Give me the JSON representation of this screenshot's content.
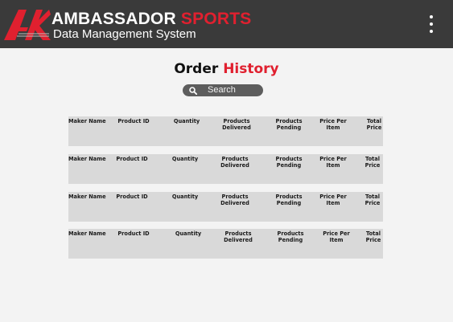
{
  "header": {
    "brand_main": "AMBASSADOR",
    "brand_accent": "SPORTS",
    "tagline": "Data Management System",
    "colors": {
      "background": "#3a3a3a",
      "accent": "#e0202f",
      "text": "#ffffff"
    },
    "menu_icon": "kebab-menu-icon"
  },
  "page": {
    "title_main": "Order",
    "title_accent": "History"
  },
  "search": {
    "placeholder": "Search",
    "icon": "search-icon"
  },
  "orders": [
    {
      "maker": "Maker Name",
      "product_id": "Product ID",
      "quantity": "Quantity",
      "delivered_1": "Products",
      "delivered_2": "Delivered",
      "pending_1": "Products",
      "pending_2": "Pending",
      "price_1": "Price Per",
      "price_2": "Item",
      "total_1": "Total",
      "total_2": "Price"
    },
    {
      "maker": "Maker Name",
      "product_id": "Product ID",
      "quantity": "Quantity",
      "delivered_1": "Products",
      "delivered_2": "Delivered",
      "pending_1": "Products",
      "pending_2": "Pending",
      "price_1": "Price Per",
      "price_2": "Item",
      "total_1": "Total",
      "total_2": "Price"
    },
    {
      "maker": "Maker Name",
      "product_id": "Product ID",
      "quantity": "Quantity",
      "delivered_1": "Products",
      "delivered_2": "Delivered",
      "pending_1": "Products",
      "pending_2": "Pending",
      "price_1": "Price Per",
      "price_2": "Item",
      "total_1": "Total",
      "total_2": "Price"
    },
    {
      "maker": "Maker Name",
      "product_id": "Product ID",
      "quantity": "Quantity",
      "delivered_1": "Products",
      "delivered_2": "Delivered",
      "pending_1": "Products",
      "pending_2": "Pending",
      "price_1": "Price Per",
      "price_2": "Item",
      "total_1": "Total",
      "total_2": "Price"
    }
  ]
}
